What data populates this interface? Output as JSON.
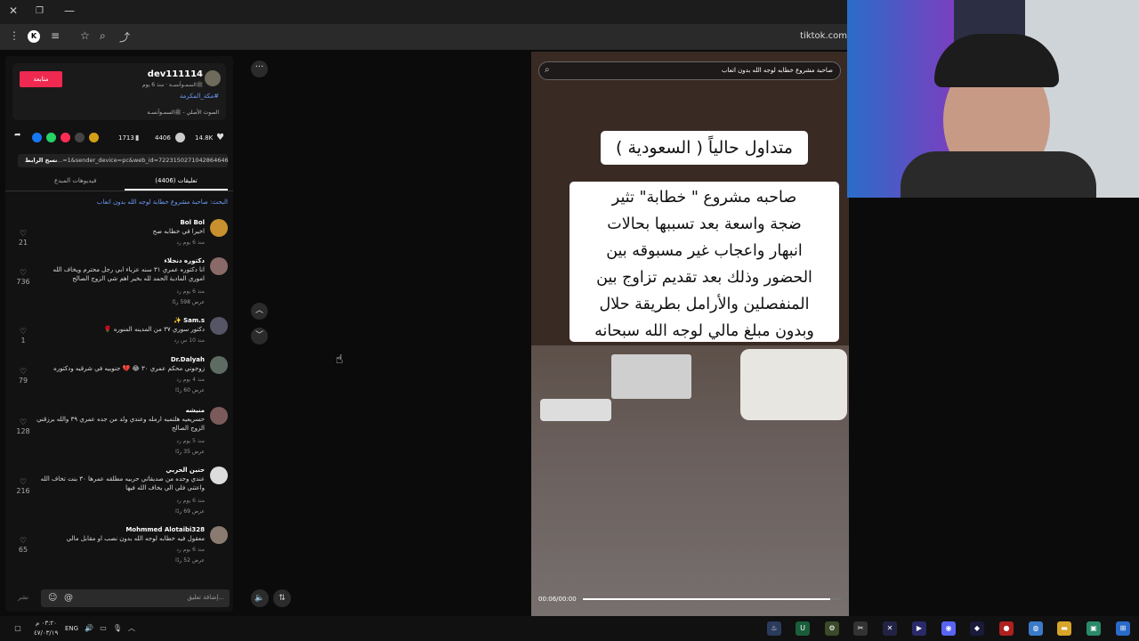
{
  "browser": {
    "url": "tiktok.com",
    "profile_initial": "K"
  },
  "author": {
    "username": "dev111114",
    "subline": "ﷺالسمـوآنسـة · منذ 6 يوم",
    "hashtag": "#مكة_المكرمة",
    "music": "الصوت الأصلي - ﷺالسمـوآنسـة",
    "follow_label": "متابعة"
  },
  "stats": {
    "likes": "14.8K",
    "comments": "4406",
    "saves": "1713"
  },
  "link": {
    "url": "...=1&sender_device=pc&web_id=7223150271042864646",
    "copy_label": "نسخ الرابط"
  },
  "tabs": {
    "comments": "تعليقات (4406)",
    "creator_videos": "فيديوهات المبدع"
  },
  "search_note": "البحث: صاحبة مشروع خطابة لوجه الله بدون اتعاب",
  "comments": [
    {
      "name": "Bol Bol",
      "text": "اخيرا في خطابه صح",
      "meta": "منذ 6 يوم   رد",
      "likes": "21",
      "replies": "",
      "avatar": "#c8902e"
    },
    {
      "name": "دكتوره دنجلاء",
      "text": "انا دكتوره عمري ٣١ سنه عزباء ابي رجل محترم ويخاف الله اموري المادية الحمد لله بخير اهم شي الزوج الصالح",
      "meta": "منذ 6 يوم   رد",
      "likes": "736",
      "replies": "عرض 598 ردًا",
      "avatar": "#8a6a68"
    },
    {
      "name": "Sam.s ✨",
      "text": "دكتور سوري ٣٧ من المدينه المنوره 🌹",
      "meta": "منذ 10 س   رد",
      "likes": "1",
      "replies": "",
      "avatar": "#556"
    },
    {
      "name": "Dr.Dalyah",
      "text": "زوجوني محكم عمري ٣٠ 😂 💔 جنوبيه في شرقيه ودكتوره",
      "meta": "منذ 4 يوم   رد",
      "likes": "79",
      "replies": "عرض 60 ردًا",
      "avatar": "#5d6b62"
    },
    {
      "name": "منيشه",
      "text": "حسريعيه هلتميه ارمله وعندي ولد من جده عمري ٣٩ والله برزقني الزوج الصالح",
      "meta": "منذ 5 يوم   رد",
      "likes": "128",
      "replies": "عرض 35 ردًا",
      "avatar": "#7a5a5a"
    },
    {
      "name": "حنين الحربي",
      "text": "عندي وحده من صديقاتي حربيه مطلقه عمرها ٣٠ بنت تخاف الله واعتني فلي الي يخاف الله فيها",
      "meta": "منذ 6 يوم   رد",
      "likes": "216",
      "replies": "عرض 69 ردًا",
      "avatar": "#ddd"
    },
    {
      "name": "Mohmmed Alotaibi328",
      "text": "معقول فيه خطابه لوجه الله بدون نصب او مقابل مالي",
      "meta": "منذ 6 يوم   رد",
      "likes": "65",
      "replies": "عرض 52 ردًا",
      "avatar": "#8a7a70"
    }
  ],
  "input": {
    "placeholder": "إضافة تعليق...",
    "post_label": "نشر"
  },
  "video": {
    "search_text": "صاحبة مشروع خطابه لوجه الله بدون اتعاب",
    "caption_title": "متداول حالياً ( السعودية )",
    "caption_body": [
      "صاحبه مشروع \" خطابة\" تثير",
      "ضجة واسعة بعد تسببها بحالات",
      "انبهار واعجاب غير مسبوقه بين",
      "الحضور وذلك بعد تقديم تزاوج بين",
      "المنفصلين والأرامل بطريقة حلال",
      "وبدون مبلغ مالي لوجه الله سبحانه"
    ],
    "time": "00:06/00:00",
    "progress": 0.96
  },
  "taskbar": {
    "lang": "ENG",
    "time": "٠٣:٢٠ م",
    "date": "٤٧/٠٣/١٩"
  }
}
